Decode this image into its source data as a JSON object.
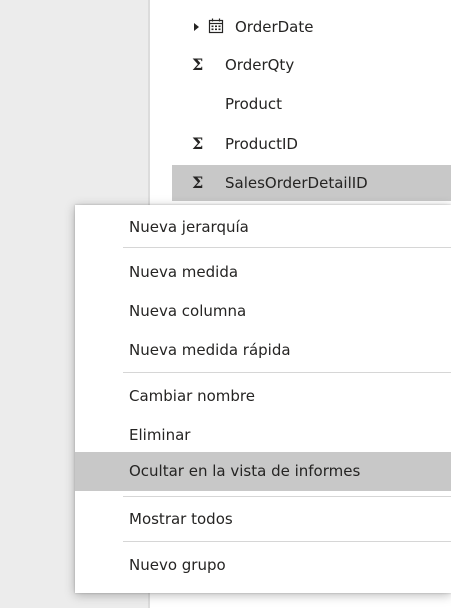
{
  "fields": [
    {
      "label": "OrderDate",
      "icon": "calendar-icon",
      "expandable": true
    },
    {
      "label": "OrderQty",
      "icon": "sigma-icon"
    },
    {
      "label": "Product",
      "icon": ""
    },
    {
      "label": "ProductID",
      "icon": "sigma-icon"
    },
    {
      "label": "SalesOrderDetailID",
      "icon": "sigma-icon",
      "selected": true
    }
  ],
  "sigma_symbol": "Σ",
  "context_menu": {
    "items": [
      {
        "label": "Nueva jerarquía"
      },
      {
        "label": "Nueva medida"
      },
      {
        "label": "Nueva columna"
      },
      {
        "label": "Nueva medida rápida"
      },
      {
        "label": "Cambiar nombre"
      },
      {
        "label": "Eliminar"
      },
      {
        "label": "Ocultar en la vista de informes",
        "highlighted": true
      },
      {
        "label": "Mostrar todos"
      },
      {
        "label": "Nuevo grupo"
      }
    ]
  },
  "colors": {
    "selected_row": "#c8c8c8",
    "highlighted_item": "#c8c8c8",
    "gutter": "#ececec",
    "text": "#252423"
  }
}
